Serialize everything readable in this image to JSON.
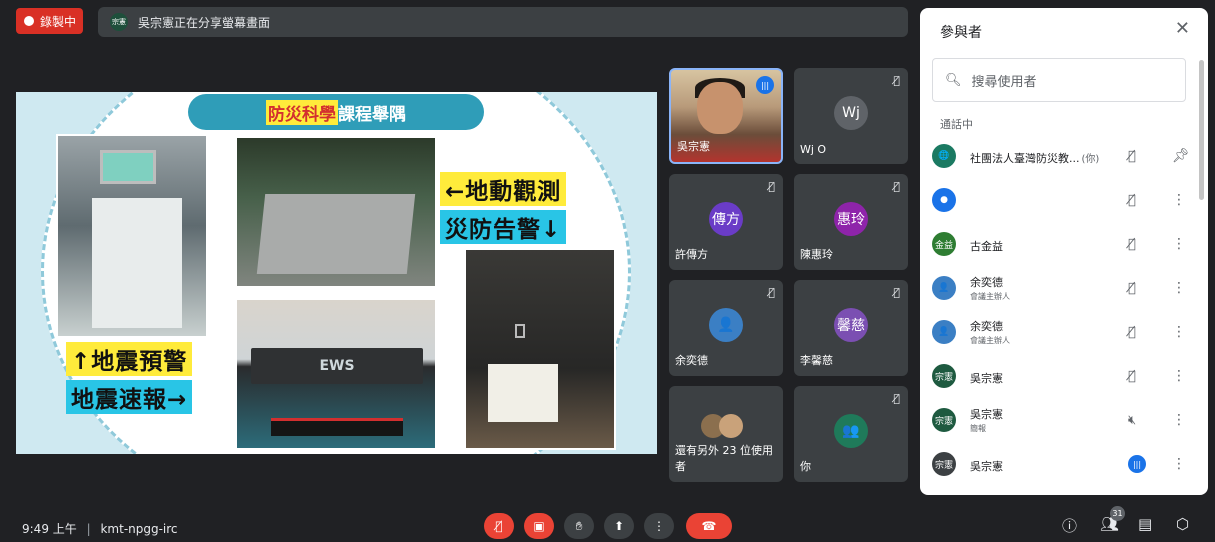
{
  "top": {
    "recording_label": "錄製中",
    "presenter_initials": "宗憲",
    "presenting_text": "吳宗憲正在分享螢幕畫面"
  },
  "slide": {
    "title_highlight": "防災科學",
    "title_rest": "課程舉隅",
    "caption_ground_motion": "←地動觀測",
    "caption_disaster_alarm": "災防告警↓",
    "caption_eq_warning": "↑地震預警",
    "caption_eq_report": "地震速報→",
    "device_brand": "EWS"
  },
  "tiles": [
    {
      "name": "吳宗憲",
      "type": "camera",
      "talking": true
    },
    {
      "name": "Wj O",
      "avatar": "Wj",
      "color": "#5f6368",
      "muted": true
    },
    {
      "name": "許傳方",
      "avatar": "傳方",
      "color": "#6a3cc7",
      "muted": true
    },
    {
      "name": "陳惠玲",
      "avatar": "惠玲",
      "color": "#8e24aa",
      "muted": true
    },
    {
      "name": "余奕德",
      "avatar": "",
      "color": "#3b7fc4",
      "muted": true
    },
    {
      "name": "李馨慈",
      "avatar": "馨慈",
      "color": "#7b4fb2",
      "muted": true
    },
    {
      "name": "還有另外 23 位使用者",
      "avatar": "",
      "color": "#8b6f4e"
    },
    {
      "name": "你",
      "avatar": "",
      "color": "#1f7a5a",
      "muted": true
    }
  ],
  "panel": {
    "title": "參與者",
    "search_placeholder": "搜尋使用者",
    "section": "通話中",
    "you_label": "(你)",
    "people": [
      {
        "name": "社團法人臺灣防災教...",
        "sub": "",
        "avatar": "",
        "color": "#1b7a62",
        "you": true
      },
      {
        "name": "",
        "sub": "",
        "avatar": "",
        "color": "#1a73e8"
      },
      {
        "name": "古金益",
        "sub": "",
        "avatar": "金益",
        "color": "#2e7d32"
      },
      {
        "name": "余奕德",
        "sub": "會議主辦人",
        "avatar": "",
        "color": "#3b7fc4"
      },
      {
        "name": "余奕德",
        "sub": "會議主辦人",
        "avatar": "",
        "color": "#3b7fc4"
      },
      {
        "name": "吳宗憲",
        "sub": "",
        "avatar": "宗憲",
        "color": "#1e5a40"
      },
      {
        "name": "吳宗憲",
        "sub": "簡報",
        "avatar": "宗憲",
        "color": "#1e5a40"
      },
      {
        "name": "吳宗憲",
        "sub": "",
        "avatar": "宗憲",
        "color": "#3c4043"
      }
    ]
  },
  "bottom": {
    "time": "9:49 上午",
    "meeting_code": "kmt-npgg-irc",
    "participant_count": "31"
  },
  "colors": {
    "accent": "#1a73e8",
    "danger": "#ea4335",
    "bg": "#202124"
  }
}
